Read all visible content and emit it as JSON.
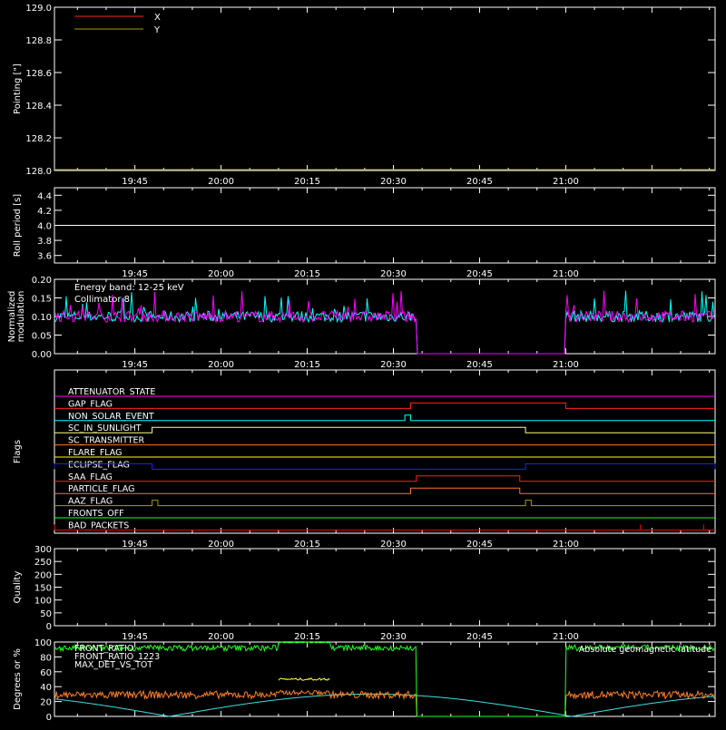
{
  "time_ticks": [
    "19:45",
    "20:00",
    "20:15",
    "20:30",
    "20:45",
    "21:00"
  ],
  "chart_data": [
    {
      "type": "line",
      "ylabel": "Pointing [\"]",
      "ylim": [
        128.0,
        129.0
      ],
      "yticks": [
        "129.0",
        "128.8",
        "128.6",
        "128.4",
        "128.2",
        "128.0"
      ],
      "legend": [
        {
          "name": "X",
          "color": "#ff2020"
        },
        {
          "name": "Y",
          "color": "#a0a000"
        }
      ],
      "series": []
    },
    {
      "type": "line",
      "ylabel": "Roll period [s]",
      "ylim": [
        3.5,
        4.5
      ],
      "yticks": [
        "4.4",
        "4.2",
        "4.0",
        "3.8",
        "3.6"
      ],
      "series": [
        {
          "x": [
            "19:31",
            "21:26"
          ],
          "values": [
            4.0,
            4.0
          ]
        }
      ]
    },
    {
      "type": "line",
      "ylabel": [
        "Normalized",
        "modulation"
      ],
      "ylim": [
        0.0,
        0.2
      ],
      "yticks": [
        "0.20",
        "0.15",
        "0.10",
        "0.05",
        "0.00"
      ],
      "annotations": [
        "Energy band: 12-25 keV",
        "Collimator 8"
      ],
      "series": [
        {
          "color": "#00ffff",
          "gaps": [
            [
              "20:34",
              "21:00"
            ]
          ],
          "level": 0.1
        },
        {
          "color": "#ff00ff",
          "gaps": [
            [
              "20:34",
              "21:00"
            ]
          ],
          "level": 0.1
        }
      ]
    },
    {
      "type": "line",
      "ylabel": "Flags",
      "flags": [
        {
          "label": "ATTENUATOR_STATE",
          "color": "#ff00ff",
          "high": []
        },
        {
          "label": "GAP_FLAG",
          "color": "#ff2020",
          "high": [
            [
              "20:33",
              "21:00"
            ]
          ]
        },
        {
          "label": "NON_SOLAR_EVENT",
          "color": "#00ffff",
          "high": [
            [
              "20:32",
              "20:33"
            ]
          ]
        },
        {
          "label": "SC_IN_SUNLIGHT",
          "color": "#ffff80",
          "high": [
            [
              "19:48",
              "20:53"
            ]
          ]
        },
        {
          "label": "SC_TRANSMITTER",
          "color": "#ff7030",
          "high": []
        },
        {
          "label": "FLARE_FLAG",
          "color": "#ffff00",
          "high": []
        },
        {
          "label": "ECLIPSE_FLAG",
          "color": "#2020ff",
          "high": [
            [
              "19:31",
              "19:48"
            ],
            [
              "20:53",
              "21:26"
            ]
          ]
        },
        {
          "label": "SAA_FLAG",
          "color": "#ff2020",
          "high": [
            [
              "20:34",
              "20:52"
            ]
          ]
        },
        {
          "label": "PARTICLE_FLAG",
          "color": "#ff7030",
          "high": [
            [
              "20:33",
              "20:52"
            ]
          ]
        },
        {
          "label": "AAZ_FLAG",
          "color": "#a0a000",
          "high": [
            [
              "19:48",
              "19:49"
            ],
            [
              "20:53",
              "20:54"
            ]
          ]
        },
        {
          "label": "FRONTS_OFF",
          "color": "#20ff20",
          "high": []
        },
        {
          "label": "BAD_PACKETS",
          "color": "#ff0000",
          "high": [
            [
              "19:31",
              "19:31"
            ],
            [
              "21:13",
              "21:13"
            ],
            [
              "21:24",
              "21:24"
            ]
          ]
        }
      ]
    },
    {
      "type": "line",
      "ylabel": "Quality",
      "ylim": [
        0,
        300
      ],
      "yticks": [
        "300",
        "250",
        "200",
        "150",
        "100",
        "50",
        "0"
      ],
      "series": []
    },
    {
      "type": "line",
      "ylabel": "Degrees or %",
      "ylim": [
        0,
        100
      ],
      "yticks": [
        "100",
        "80",
        "60",
        "40",
        "20",
        "0"
      ],
      "legend": [
        {
          "name": "FRONT_RATIO",
          "color": "#20ff20"
        },
        {
          "name": "FRONT_RATIO_1223",
          "color": "#ffff40"
        },
        {
          "name": "MAX_DET_VS_TOT",
          "color": "#ff8020"
        }
      ],
      "annotations": [
        "Absolute geomagnetic latitude"
      ],
      "annotation_color": "#40e0e0"
    }
  ]
}
